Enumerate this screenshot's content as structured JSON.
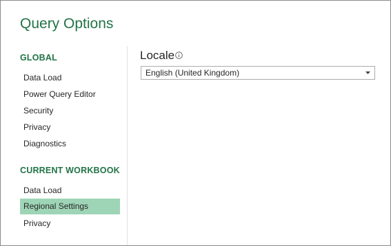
{
  "dialog": {
    "title": "Query Options"
  },
  "sidebar": {
    "global": {
      "heading": "GLOBAL",
      "items": [
        {
          "label": "Data Load"
        },
        {
          "label": "Power Query Editor"
        },
        {
          "label": "Security"
        },
        {
          "label": "Privacy"
        },
        {
          "label": "Diagnostics"
        }
      ]
    },
    "current_workbook": {
      "heading": "CURRENT WORKBOOK",
      "items": [
        {
          "label": "Data Load"
        },
        {
          "label": "Regional Settings",
          "selected": true
        },
        {
          "label": "Privacy"
        }
      ]
    }
  },
  "main": {
    "locale": {
      "label": "Locale",
      "info_icon": "info-circle-icon",
      "selected_value": "English (United Kingdom)",
      "dropdown_icon": "chevron-down-icon"
    }
  },
  "colors": {
    "accent": "#217346",
    "selected_bg": "#9fd5b7",
    "divider": "#e1e1e1",
    "window_border": "#8a8a8a",
    "text": "#262626"
  }
}
